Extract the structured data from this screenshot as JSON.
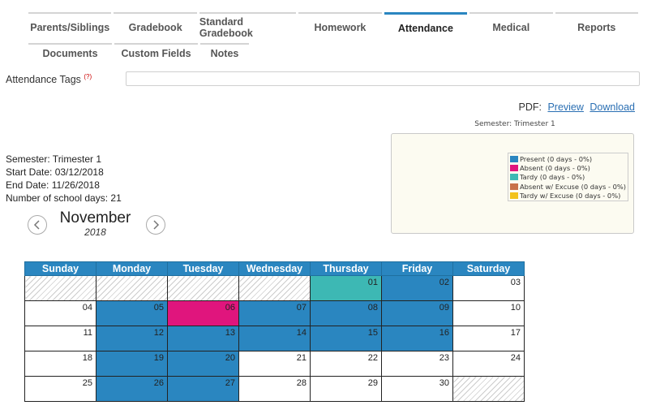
{
  "tabs": {
    "row1": [
      {
        "label": "Parents/Siblings",
        "active": false
      },
      {
        "label": "Gradebook",
        "active": false
      },
      {
        "label": "Standard Gradebook",
        "active": false
      },
      {
        "label": "Homework",
        "active": false
      },
      {
        "label": "Attendance",
        "active": true
      },
      {
        "label": "Medical",
        "active": false
      },
      {
        "label": "Reports",
        "active": false
      }
    ],
    "row2": [
      {
        "label": "Documents"
      },
      {
        "label": "Custom Fields"
      },
      {
        "label": "Notes"
      }
    ]
  },
  "attendance_tags": {
    "label": "Attendance Tags",
    "help": "(?)",
    "value": ""
  },
  "pdf": {
    "label": "PDF:",
    "preview": "Preview",
    "download": "Download"
  },
  "chart": {
    "title": "Semester: Trimester 1",
    "legend": [
      {
        "label": "Present (0 days - 0%)",
        "color": "#2a86c0"
      },
      {
        "label": "Absent (0 days - 0%)",
        "color": "#e0157d"
      },
      {
        "label": "Tardy (0 days - 0%)",
        "color": "#3db8b4"
      },
      {
        "label": "Absent w/ Excuse (0 days - 0%)",
        "color": "#c8714a"
      },
      {
        "label": "Tardy w/ Excuse (0 days - 0%)",
        "color": "#f2c21b"
      }
    ]
  },
  "info": {
    "semester": "Semester: Trimester 1",
    "start": "Start Date: 03/12/2018",
    "end": "End Date: 11/26/2018",
    "school_days": "Number of school days: 21"
  },
  "calendar": {
    "month": "November",
    "year": "2018",
    "prev_icon": "chevron-left-icon",
    "next_icon": "chevron-right-icon",
    "headers": [
      "Sunday",
      "Monday",
      "Tuesday",
      "Wednesday",
      "Thursday",
      "Friday",
      "Saturday"
    ],
    "weeks": [
      [
        {
          "day": "",
          "status": "empty"
        },
        {
          "day": "",
          "status": "empty"
        },
        {
          "day": "",
          "status": "empty"
        },
        {
          "day": "",
          "status": "empty"
        },
        {
          "day": "01",
          "status": "tardy"
        },
        {
          "day": "02",
          "status": "present"
        },
        {
          "day": "03",
          "status": "none"
        }
      ],
      [
        {
          "day": "04",
          "status": "none"
        },
        {
          "day": "05",
          "status": "present"
        },
        {
          "day": "06",
          "status": "absent"
        },
        {
          "day": "07",
          "status": "present"
        },
        {
          "day": "08",
          "status": "present"
        },
        {
          "day": "09",
          "status": "present"
        },
        {
          "day": "10",
          "status": "none"
        }
      ],
      [
        {
          "day": "11",
          "status": "none"
        },
        {
          "day": "12",
          "status": "present"
        },
        {
          "day": "13",
          "status": "present"
        },
        {
          "day": "14",
          "status": "present"
        },
        {
          "day": "15",
          "status": "present"
        },
        {
          "day": "16",
          "status": "present"
        },
        {
          "day": "17",
          "status": "none"
        }
      ],
      [
        {
          "day": "18",
          "status": "none"
        },
        {
          "day": "19",
          "status": "present"
        },
        {
          "day": "20",
          "status": "present"
        },
        {
          "day": "21",
          "status": "none"
        },
        {
          "day": "22",
          "status": "none"
        },
        {
          "day": "23",
          "status": "none"
        },
        {
          "day": "24",
          "status": "none"
        }
      ],
      [
        {
          "day": "25",
          "status": "none"
        },
        {
          "day": "26",
          "status": "present"
        },
        {
          "day": "27",
          "status": "present"
        },
        {
          "day": "28",
          "status": "none"
        },
        {
          "day": "29",
          "status": "none"
        },
        {
          "day": "30",
          "status": "none"
        },
        {
          "day": "",
          "status": "empty"
        }
      ]
    ]
  }
}
